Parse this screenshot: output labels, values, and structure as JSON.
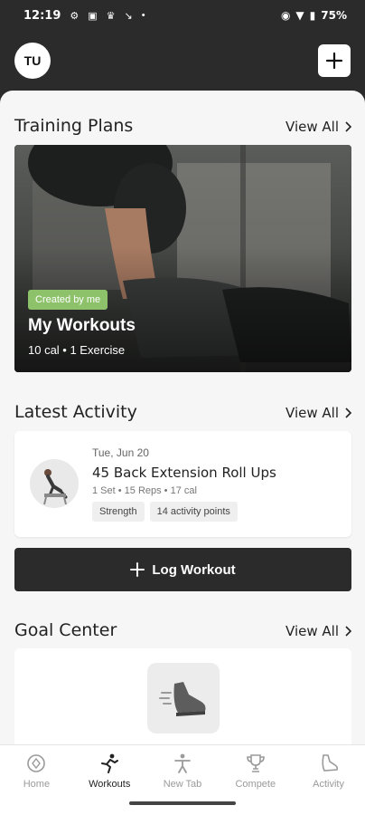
{
  "status_bar": {
    "time": "12:19",
    "battery": "75%",
    "icons": [
      "gear-icon",
      "document-icon",
      "crown-icon",
      "arrow-icon",
      "dot-icon"
    ]
  },
  "header": {
    "avatar_initials": "TU",
    "add_icon": "plus-icon"
  },
  "training_plans": {
    "title": "Training Plans",
    "view_all": "View All",
    "card": {
      "badge": "Created by me",
      "title": "My Workouts",
      "subtitle": "10 cal • 1 Exercise"
    }
  },
  "latest_activity": {
    "title": "Latest Activity",
    "view_all": "View All",
    "item": {
      "date": "Tue, Jun 20",
      "name": "45 Back Extension Roll Ups",
      "detail": "1 Set • 15 Reps • 17 cal",
      "tags": [
        "Strength",
        "14 activity points"
      ]
    }
  },
  "log_workout": {
    "label": "Log Workout"
  },
  "goal_center": {
    "title": "Goal Center",
    "view_all": "View All"
  },
  "bottom_nav": {
    "items": [
      {
        "label": "Home",
        "icon": "home-icon",
        "active": false
      },
      {
        "label": "Workouts",
        "icon": "workouts-icon",
        "active": true
      },
      {
        "label": "New Tab",
        "icon": "person-icon",
        "active": false
      },
      {
        "label": "Compete",
        "icon": "trophy-icon",
        "active": false
      },
      {
        "label": "Activity",
        "icon": "shoe-icon",
        "active": false
      }
    ]
  },
  "colors": {
    "dark": "#2b2b2b",
    "badge_green": "#8dc26a",
    "background": "#f6f6f6"
  }
}
